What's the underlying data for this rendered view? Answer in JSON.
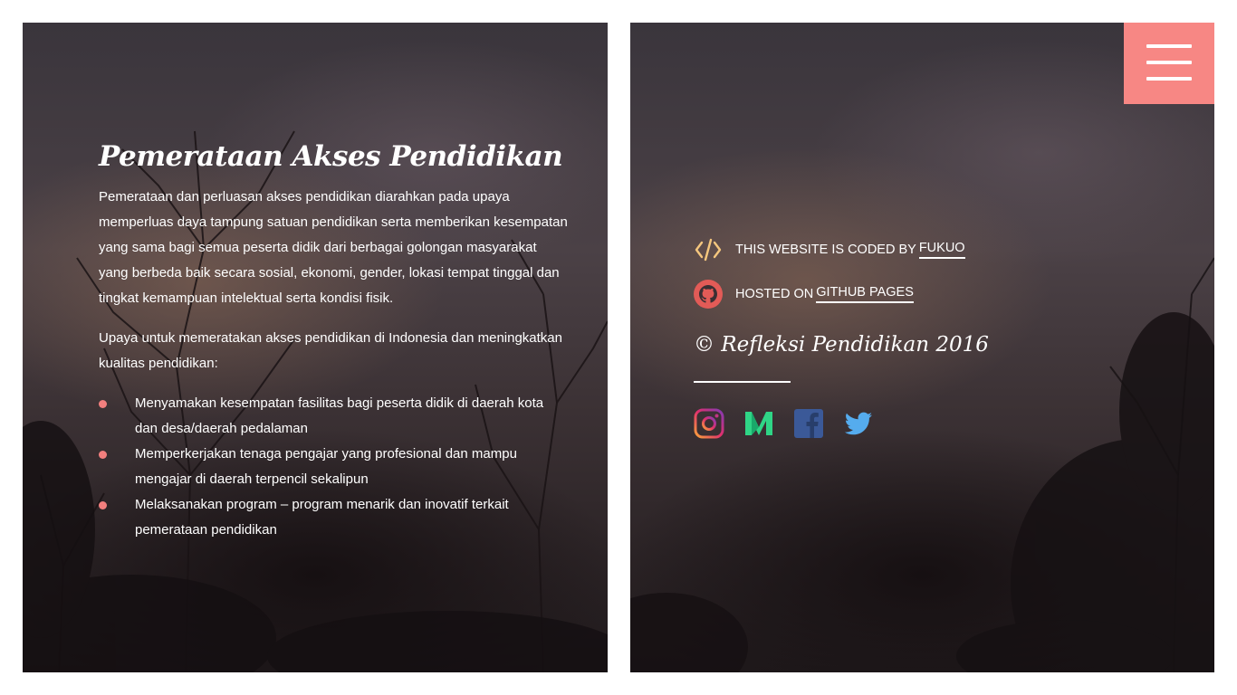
{
  "article": {
    "title": "Pemerataan Akses Pendidikan",
    "paragraph1": "Pemerataan dan perluasan akses pendidikan diarahkan pada upaya memperluas daya tampung satuan pendidikan serta memberikan kesempatan yang sama bagi semua peserta didik dari berbagai golongan masyarakat yang berbeda baik secara sosial, ekonomi, gender, lokasi tempat tinggal dan tingkat kemampuan intelektual serta kondisi fisik.",
    "paragraph2": "Upaya untuk memeratakan akses pendidikan di Indonesia dan meningkatkan kualitas pendidikan:",
    "list": [
      "Menyamakan kesempatan fasilitas bagi peserta didik di daerah kota dan desa/daerah pedalaman",
      "Memperkerjakan tenaga pengajar yang profesional dan mampu mengajar di daerah terpencil sekalipun",
      "Melaksanakan program – program menarik dan inovatif terkait pemerataan pendidikan"
    ]
  },
  "menu": {
    "icon": "hamburger-menu-icon",
    "color": "#f78784"
  },
  "credits": {
    "coded_by_text": "THIS WEBSITE IS CODED BY",
    "coded_by_link": "FUKUO",
    "hosted_on_text": "HOSTED ON",
    "hosted_on_link": "GITHUB PAGES"
  },
  "copyright": "© Refleksi Pendidikan 2016",
  "social": [
    "instagram-icon",
    "medium-icon",
    "facebook-icon",
    "twitter-icon"
  ],
  "colors": {
    "accent": "#f27f7e",
    "code_icon": "#f5c77e",
    "github_icon": "#e25b57",
    "medium": "#2fd586",
    "facebook": "#3b5998",
    "twitter": "#55acee"
  }
}
